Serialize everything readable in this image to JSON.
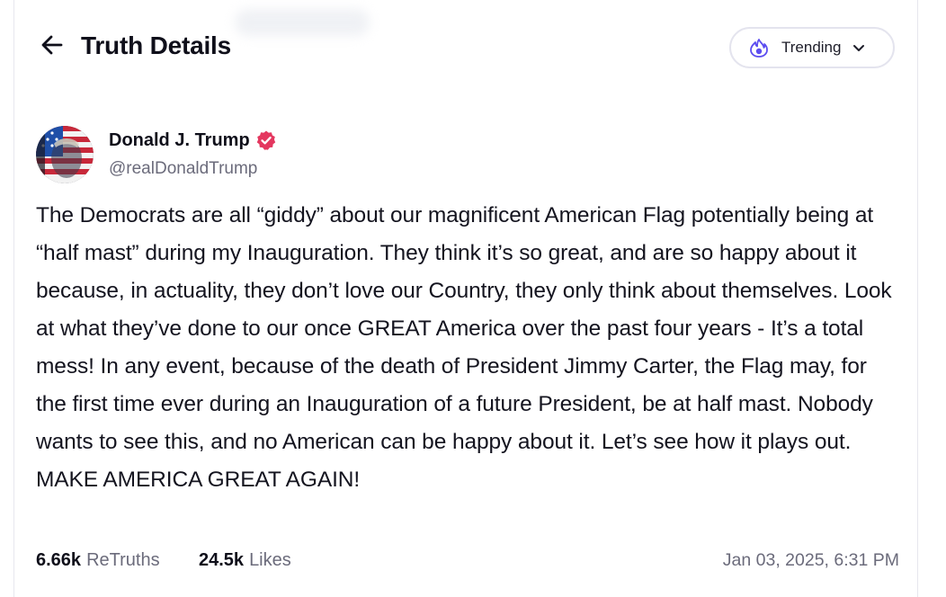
{
  "header": {
    "title": "Truth Details",
    "back_icon": "arrow-left-icon",
    "feed_selector": {
      "label": "Trending",
      "icon": "flame-icon",
      "accent_color": "#5b4cf0"
    }
  },
  "post": {
    "author": {
      "display_name": "Donald J. Trump",
      "handle": "@realDonaldTrump",
      "verified": true,
      "verified_color": "#e4375f"
    },
    "text": "The Democrats are all “giddy” about our magnificent American Flag potentially being at “half mast” during my Inauguration. They think it’s so great, and are so happy about it because, in actuality, they don’t love our Country, they only think about themselves. Look at what they’ve done to our once GREAT America over the past four years - It’s a total mess! In any event, because of the death of President Jimmy Carter, the Flag may, for the first time ever during an Inauguration of a future President, be at half mast. Nobody wants to see this, and no American can be happy about it. Let’s see how it plays out. MAKE AMERICA GREAT AGAIN!",
    "stats": {
      "retruths_count": "6.66k",
      "retruths_label": "ReTruths",
      "likes_count": "24.5k",
      "likes_label": "Likes"
    },
    "timestamp": "Jan 03, 2025, 6:31 PM"
  }
}
